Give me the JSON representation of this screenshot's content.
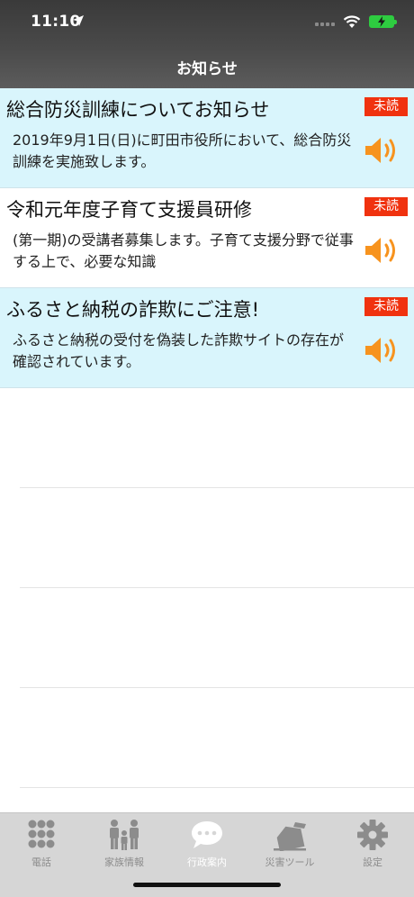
{
  "status_bar": {
    "time": "11:10"
  },
  "nav": {
    "title": "お知らせ"
  },
  "notices": [
    {
      "title": "総合防災訓練についてお知らせ",
      "badge": "未読",
      "body": "2019年9月1日(日)に町田市役所において、総合防災訓練を実施致します。"
    },
    {
      "title": "令和元年度子育て支援員研修",
      "badge": "未読",
      "body": "(第一期)の受講者募集します。子育て支援分野で従事する上で、必要な知識"
    },
    {
      "title": "ふるさと納税の詐欺にご注意!",
      "badge": "未読",
      "body": "ふるさと納税の受付を偽装した詐欺サイトの存在が確認されています。"
    }
  ],
  "tabs": [
    {
      "label": "電話",
      "icon": "keypad-icon"
    },
    {
      "label": "家族情報",
      "icon": "family-icon"
    },
    {
      "label": "行政案内",
      "icon": "chat-bubble-icon",
      "active": true
    },
    {
      "label": "災害ツール",
      "icon": "collapsed-house-icon"
    },
    {
      "label": "設定",
      "icon": "gear-icon"
    }
  ],
  "colors": {
    "unread_bg": "#d9f5fc",
    "badge": "#f0320f",
    "speaker": "#f7931e",
    "accent": "#2ecc40"
  }
}
